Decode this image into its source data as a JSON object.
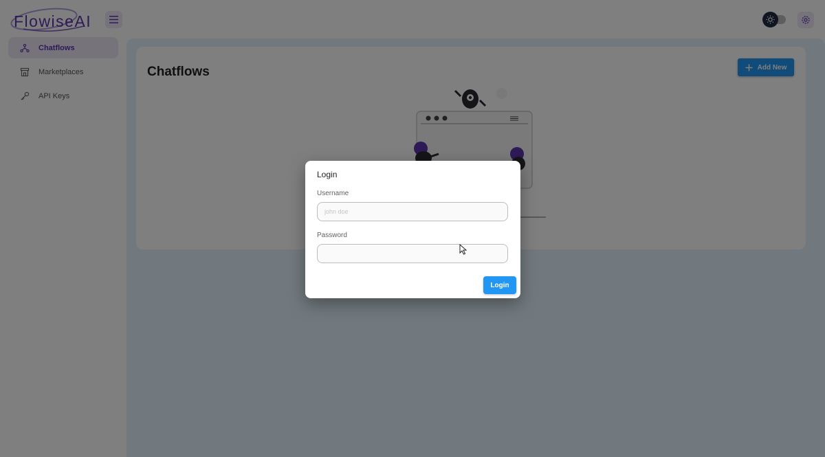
{
  "app": {
    "logo_text": "FlowiseAI"
  },
  "sidebar": {
    "items": [
      {
        "label": "Chatflows",
        "icon": "hierarchy-icon",
        "active": true
      },
      {
        "label": "Marketplaces",
        "icon": "building-store-icon",
        "active": false
      },
      {
        "label": "API Keys",
        "icon": "key-icon",
        "active": false
      }
    ]
  },
  "main": {
    "title": "Chatflows",
    "add_button_label": "Add New"
  },
  "dialog": {
    "title": "Login",
    "username_label": "Username",
    "username_placeholder": "john doe",
    "username_value": "",
    "password_label": "Password",
    "password_value": "",
    "login_button_label": "Login"
  },
  "colors": {
    "primary": "#2196f3",
    "secondary": "#5e35b1",
    "secondary_light": "#ede7f6",
    "background": "#e3f2fd"
  }
}
